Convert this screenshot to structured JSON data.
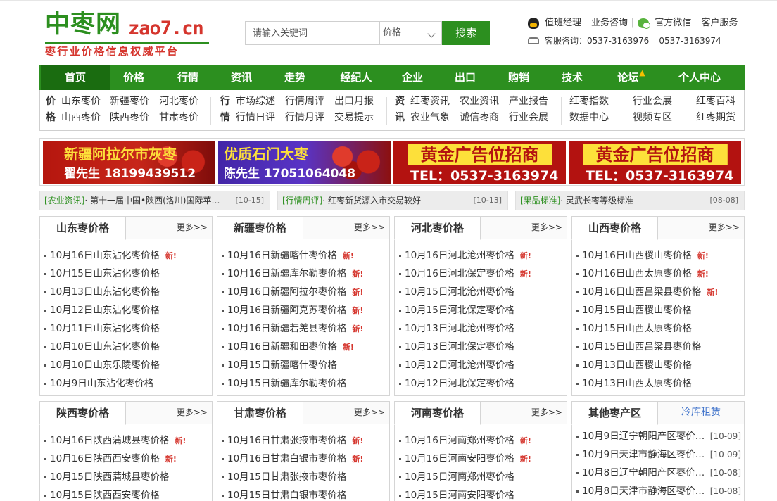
{
  "brand": {
    "logo_cn": "中枣网",
    "logo_en": "zao7.cn",
    "slogan": "枣行业价格信息权威平台"
  },
  "search": {
    "placeholder": "请输入关键词",
    "select_value": "价格",
    "button_label": "搜索"
  },
  "header_links": {
    "duty_manager": "值班经理",
    "business": "业务咨询",
    "separator": "|",
    "wechat": "官方微信",
    "customer_service": "客户服务",
    "hotline_label": "客服咨询：0537-3163976",
    "hotline_2": "0537-3163974"
  },
  "nav": {
    "items": [
      {
        "label": "首页",
        "active": true
      },
      {
        "label": "价格"
      },
      {
        "label": "行情"
      },
      {
        "label": "资讯"
      },
      {
        "label": "走势"
      },
      {
        "label": "经纪人"
      },
      {
        "label": "企业"
      },
      {
        "label": "出口"
      },
      {
        "label": "购销"
      },
      {
        "label": "技术"
      },
      {
        "label": "论坛"
      },
      {
        "label": "个人中心"
      }
    ]
  },
  "subnav": {
    "price": {
      "head": [
        "价",
        "格"
      ],
      "links": [
        "山东枣价",
        "新疆枣价",
        "河北枣价",
        "山西枣价",
        "陕西枣价",
        "甘肃枣价"
      ]
    },
    "market": {
      "head": [
        "行",
        "情"
      ],
      "links": [
        "市场综述",
        "行情周评",
        "出口月报",
        "行情日评",
        "行情月评",
        "交易提示"
      ]
    },
    "news": {
      "head": [
        "资",
        "讯"
      ],
      "links": [
        "红枣资讯",
        "农业资讯",
        "产业报告",
        "农业气象",
        "诚信枣商",
        "行业会展"
      ]
    },
    "extra": [
      "红枣指数",
      "行业会展",
      "红枣百科",
      "数据中心",
      "视频专区",
      "红枣期货"
    ]
  },
  "banners": [
    {
      "line1": "新疆阿拉尔市灰枣",
      "line2": "翟先生 18199439512"
    },
    {
      "line1": "优质石门大枣",
      "line2": "陈先生 17051064048"
    },
    {
      "line1": "黄金广告位招商",
      "line2": "TEL：0537-3163974"
    },
    {
      "line1": "黄金广告位招商",
      "line2": "TEL：0537-3163974"
    }
  ],
  "news_strip": [
    {
      "cat": "[农业资讯]",
      "title": "· 第十一届中国•陕西(洛川)国际苹…",
      "date": "[10-15]"
    },
    {
      "cat": "[行情周评]",
      "title": "· 红枣新货源入市交易较好",
      "date": "[10-13]"
    },
    {
      "cat": "[果品标准]",
      "title": "· 灵武长枣等级标准",
      "date": "[08-08]"
    }
  ],
  "more_label": "更多>>",
  "new_label": "新!",
  "panels_row1": [
    {
      "title": "山东枣价格",
      "items": [
        {
          "t": "10月16日山东沾化枣价格",
          "new": true
        },
        {
          "t": "10月15日山东沾化枣价格",
          "new": false
        },
        {
          "t": "10月13日山东沾化枣价格",
          "new": false
        },
        {
          "t": "10月12日山东沾化枣价格",
          "new": false
        },
        {
          "t": "10月11日山东沾化枣价格",
          "new": false
        },
        {
          "t": "10月10日山东沾化枣价格",
          "new": false
        },
        {
          "t": "10月10日山东乐陵枣价格",
          "new": false
        },
        {
          "t": "10月9日山东沾化枣价格",
          "new": false
        }
      ]
    },
    {
      "title": "新疆枣价格",
      "items": [
        {
          "t": "10月16日新疆喀什枣价格",
          "new": true
        },
        {
          "t": "10月16日新疆库尔勒枣价格",
          "new": true
        },
        {
          "t": "10月16日新疆阿拉尔枣价格",
          "new": true
        },
        {
          "t": "10月16日新疆阿克苏枣价格",
          "new": true
        },
        {
          "t": "10月16日新疆若羌县枣价格",
          "new": true
        },
        {
          "t": "10月16日新疆和田枣价格",
          "new": true
        },
        {
          "t": "10月15日新疆喀什枣价格",
          "new": false
        },
        {
          "t": "10月15日新疆库尔勒枣价格",
          "new": false
        }
      ]
    },
    {
      "title": "河北枣价格",
      "items": [
        {
          "t": "10月16日河北沧州枣价格",
          "new": true
        },
        {
          "t": "10月16日河北保定枣价格",
          "new": true
        },
        {
          "t": "10月15日河北沧州枣价格",
          "new": false
        },
        {
          "t": "10月15日河北保定枣价格",
          "new": false
        },
        {
          "t": "10月13日河北沧州枣价格",
          "new": false
        },
        {
          "t": "10月13日河北保定枣价格",
          "new": false
        },
        {
          "t": "10月12日河北沧州枣价格",
          "new": false
        },
        {
          "t": "10月12日河北保定枣价格",
          "new": false
        }
      ]
    },
    {
      "title": "山西枣价格",
      "items": [
        {
          "t": "10月16日山西稷山枣价格",
          "new": true
        },
        {
          "t": "10月16日山西太原枣价格",
          "new": true
        },
        {
          "t": "10月16日山西吕梁县枣价格",
          "new": true
        },
        {
          "t": "10月15日山西稷山枣价格",
          "new": false
        },
        {
          "t": "10月15日山西太原枣价格",
          "new": false
        },
        {
          "t": "10月15日山西吕梁县枣价格",
          "new": false
        },
        {
          "t": "10月13日山西稷山枣价格",
          "new": false
        },
        {
          "t": "10月13日山西太原枣价格",
          "new": false
        }
      ]
    }
  ],
  "panels_row2": [
    {
      "title": "陕西枣价格",
      "items": [
        {
          "t": "10月16日陕西蒲城县枣价格",
          "new": true
        },
        {
          "t": "10月16日陕西西安枣价格",
          "new": true
        },
        {
          "t": "10月15日陕西蒲城县枣价格",
          "new": false
        },
        {
          "t": "10月15日陕西西安枣价格",
          "new": false
        }
      ]
    },
    {
      "title": "甘肃枣价格",
      "items": [
        {
          "t": "10月16日甘肃张掖市枣价格",
          "new": true
        },
        {
          "t": "10月16日甘肃白银市枣价格",
          "new": true
        },
        {
          "t": "10月15日甘肃张掖市枣价格",
          "new": false
        },
        {
          "t": "10月15日甘肃白银市枣价格",
          "new": false
        }
      ]
    },
    {
      "title": "河南枣价格",
      "items": [
        {
          "t": "10月16日河南郑州枣价格",
          "new": true
        },
        {
          "t": "10月16日河南安阳枣价格",
          "new": true
        },
        {
          "t": "10月15日河南郑州枣价格",
          "new": false
        },
        {
          "t": "10月15日河南安阳枣价格",
          "new": false
        }
      ]
    }
  ],
  "other_panel": {
    "title": "其他枣产区",
    "tab2": "冷库租赁",
    "items": [
      {
        "t": "10月9日辽宁朝阳产区枣价…",
        "date": "[10-09]"
      },
      {
        "t": "10月9日天津市静海区枣价…",
        "date": "[10-09]"
      },
      {
        "t": "10月8日辽宁朝阳产区枣价…",
        "date": "[10-08]"
      },
      {
        "t": "10月8日天津市静海区枣价…",
        "date": "[10-08]"
      }
    ]
  }
}
